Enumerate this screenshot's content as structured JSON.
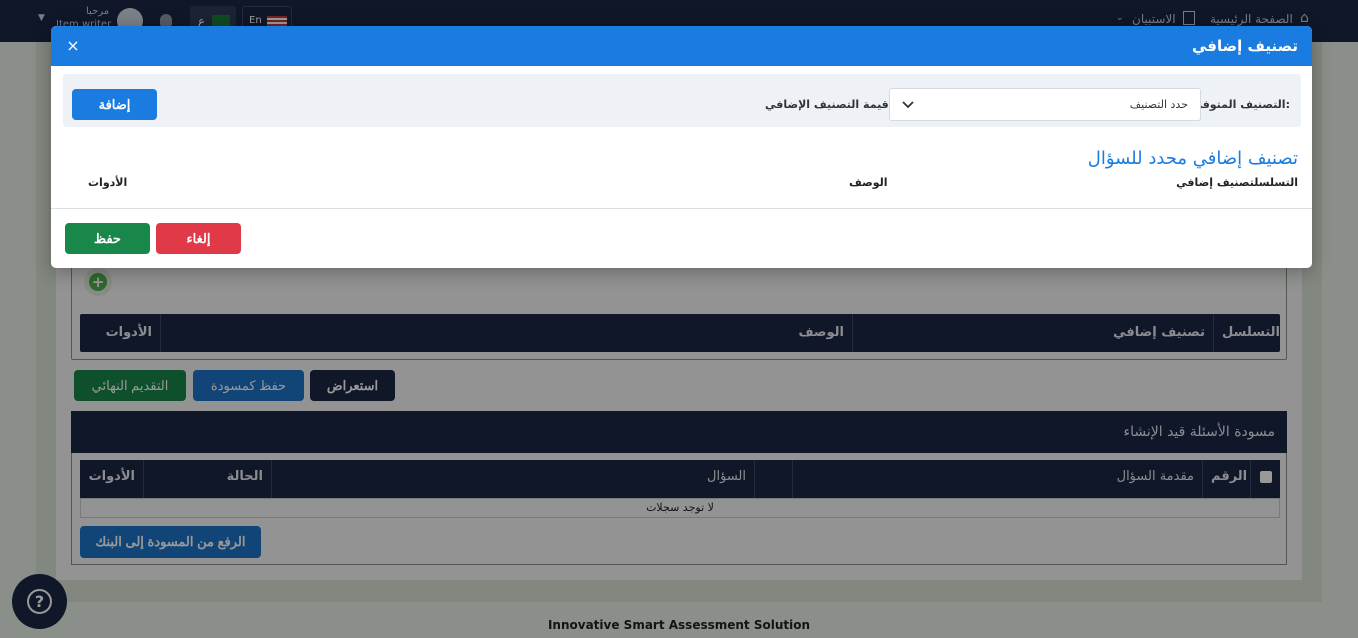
{
  "topbar": {
    "home": "الصفحة الرئيسية",
    "surveys": "الاستبيان",
    "greeting": "مرحبا",
    "username": "Item writer",
    "lang_ar": "ع",
    "lang_en": "En"
  },
  "background": {
    "table_headers": {
      "serial": "التسلسل",
      "additional_category": "تصنيف إضافي",
      "description": "الوصف",
      "tools": "الأدوات"
    },
    "buttons": {
      "final_submit": "التقديم النهائي",
      "save_draft": "حفظ كمسودة",
      "preview": "استعراض",
      "upload_draft": "الرفع من المسودة إلى البنك"
    },
    "draft_section": {
      "title": "مسودة الأسئلة قيد الإنشاء",
      "headers": {
        "number": "الرقم",
        "question_intro": "مقدمة السؤال",
        "question": "السؤال",
        "status": "الحالة",
        "tools": "الأدوات"
      },
      "empty": "لا توجد سجلات"
    },
    "footer": "Innovative Smart Assessment Solution",
    "help_symbol": "?"
  },
  "modal": {
    "title": "تصنيف إضافي",
    "close_symbol": "×",
    "available_label": "التصنيف المتوفر:",
    "select_value": "حدد التصنيف",
    "value_label": "قيمة التصنيف الإضافي",
    "add_button": "إضافة",
    "section_title": "تصنيف إضافي محدد للسؤال",
    "headers": {
      "serial_category": "التسلسلتصنيف إضافي",
      "description": "الوصف",
      "tools": "الأدوات"
    },
    "cancel_button": "إلغاء",
    "save_button": "حفظ"
  },
  "colors": {
    "modal_header": "#1a7be0",
    "navy": "#1a2744",
    "save_green": "#19864a",
    "cancel_red": "#e03a48"
  }
}
